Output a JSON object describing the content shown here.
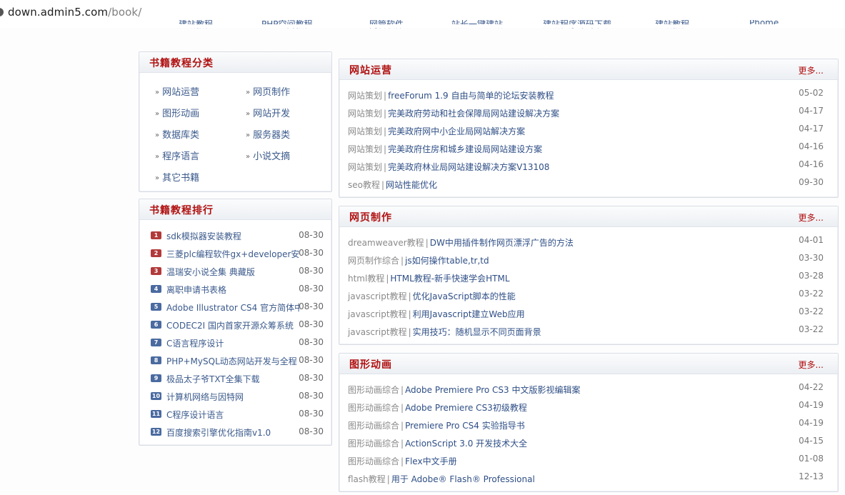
{
  "browser": {
    "url_host": "down.admin5.com",
    "url_path": "/book/"
  },
  "topnav": [
    "建站教程",
    "PHP空间教程",
    "网管软件",
    "站长一键建站",
    "建站程序源码下载",
    "建站教程",
    "Phome"
  ],
  "category_panel": {
    "title": "书籍教程分类",
    "items": [
      "网站运营",
      "网页制作",
      "图形动画",
      "网站开发",
      "数据库类",
      "服务器类",
      "程序语言",
      "小说文摘",
      "其它书籍"
    ]
  },
  "ranking_panel": {
    "title": "书籍教程排行",
    "items": [
      {
        "num": "1",
        "title": "sdk模拟器安装教程",
        "date": "08-30"
      },
      {
        "num": "2",
        "title": "三菱plc编程软件gx+developer安装",
        "date": "08-30"
      },
      {
        "num": "3",
        "title": "温瑞安小说全集 典藏版",
        "date": "08-30"
      },
      {
        "num": "4",
        "title": "离职申请书表格",
        "date": "08-30"
      },
      {
        "num": "5",
        "title": "Adobe Illustrator CS4 官方简体中",
        "date": "08-30"
      },
      {
        "num": "6",
        "title": "CODEC2I 国内首家开源众筹系统",
        "date": "08-30"
      },
      {
        "num": "7",
        "title": "C语言程序设计",
        "date": "08-30"
      },
      {
        "num": "8",
        "title": "PHP+MySQL动态网站开发与全程",
        "date": "08-30"
      },
      {
        "num": "9",
        "title": "极品太子爷TXT全集下载",
        "date": "08-30"
      },
      {
        "num": "10",
        "title": "计算机网络与因特网",
        "date": "08-30"
      },
      {
        "num": "11",
        "title": "C程序设计语言",
        "date": "08-30"
      },
      {
        "num": "12",
        "title": "百度搜索引擎优化指南v1.0",
        "date": "08-30"
      }
    ],
    "colors": {
      "top3": "#b23a3a",
      "rest": "#4a6aa0"
    }
  },
  "sections": [
    {
      "title": "网站运营",
      "more": "更多...",
      "articles": [
        {
          "cat": "网站策划",
          "title": "freeForum 1.9 自由与简单的论坛安装教程",
          "date": "05-02"
        },
        {
          "cat": "网站策划",
          "title": "完美政府劳动和社会保障局网站建设解决方案",
          "date": "04-17"
        },
        {
          "cat": "网站策划",
          "title": "完美政府网中小企业局网站解决方案",
          "date": "04-17"
        },
        {
          "cat": "网站策划",
          "title": "完美政府住房和城乡建设局网站建设方案",
          "date": "04-16"
        },
        {
          "cat": "网站策划",
          "title": "完美政府林业局网站建设解决方案V13108",
          "date": "04-16"
        },
        {
          "cat": "seo教程",
          "title": "网站性能优化",
          "date": "09-30"
        }
      ]
    },
    {
      "title": "网页制作",
      "more": "更多...",
      "articles": [
        {
          "cat": "dreamweaver教程",
          "title": "DW中用插件制作网页漂浮广告的方法",
          "date": "04-01"
        },
        {
          "cat": "网页制作综合",
          "title": "js如何操作table,tr,td",
          "date": "03-30"
        },
        {
          "cat": "html教程",
          "title": "HTML教程-新手快速学会HTML",
          "date": "03-28"
        },
        {
          "cat": "javascript教程",
          "title": "优化JavaScript脚本的性能",
          "date": "03-22"
        },
        {
          "cat": "javascript教程",
          "title": "利用Javascript建立Web应用",
          "date": "03-22"
        },
        {
          "cat": "javascript教程",
          "title": "实用技巧：随机显示不同页面背景",
          "date": "03-22"
        }
      ]
    },
    {
      "title": "图形动画",
      "more": "更多...",
      "articles": [
        {
          "cat": "图形动画综合",
          "title": "Adobe Premiere Pro CS3 中文版影视编辑案",
          "date": "04-22"
        },
        {
          "cat": "图形动画综合",
          "title": "Adobe Premiere CS3初级教程",
          "date": "04-19"
        },
        {
          "cat": "图形动画综合",
          "title": "Premiere Pro CS4 实验指导书",
          "date": "04-19"
        },
        {
          "cat": "图形动画综合",
          "title": "ActionScript 3.0 开发技术大全",
          "date": "04-15"
        },
        {
          "cat": "图形动画综合",
          "title": "Flex中文手册",
          "date": "01-08"
        },
        {
          "cat": "flash教程",
          "title": "用于 Adobe® Flash® Professional",
          "date": "12-13"
        }
      ]
    }
  ],
  "separator": "|"
}
